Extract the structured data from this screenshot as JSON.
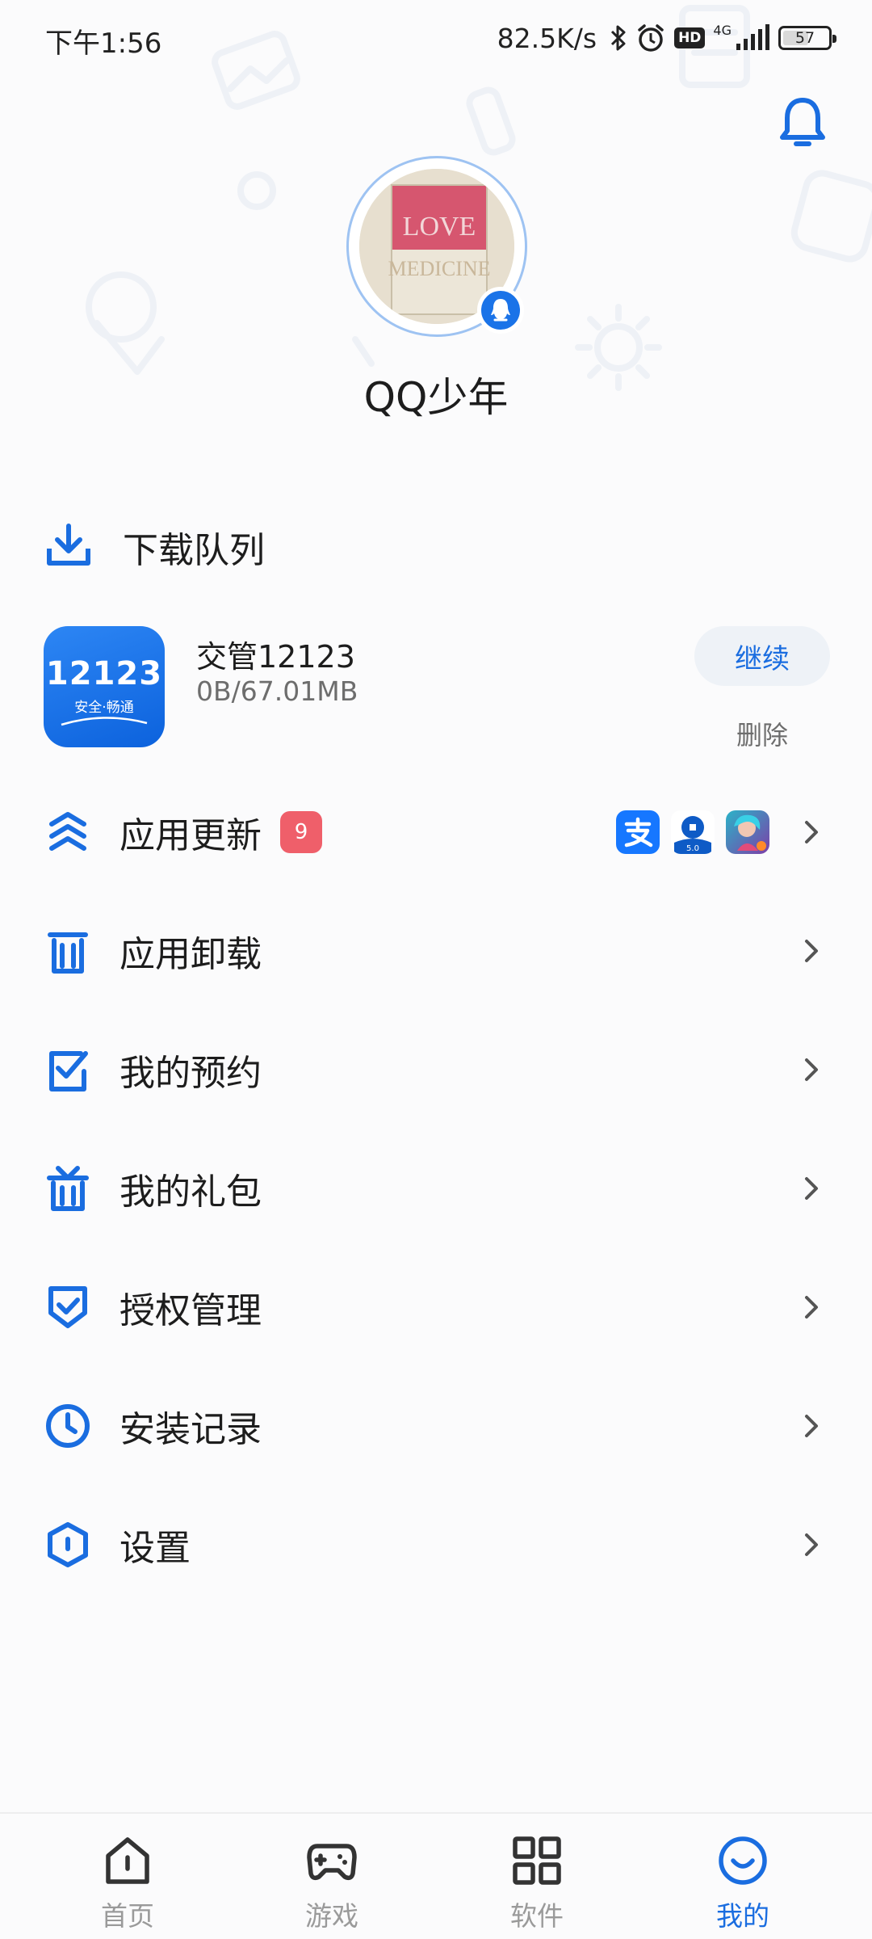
{
  "status_bar": {
    "time": "下午1:56",
    "net_speed": "82.5K/s",
    "hd": "HD",
    "network": "4G",
    "battery": "57",
    "battery_level": 0.57
  },
  "profile": {
    "username": "QQ少年",
    "avatar_text_1": "LOVE",
    "avatar_text_2": "MEDICINE"
  },
  "download_queue": {
    "title": "下载队列",
    "items": [
      {
        "name": "交管12123",
        "size": "0B/67.01MB",
        "icon_text": "12123",
        "icon_subtext": "安全·畅通",
        "continue_label": "继续",
        "delete_label": "删除"
      }
    ]
  },
  "menu": {
    "app_update": {
      "label": "应用更新",
      "badge": "9",
      "mini_apps": [
        "alipay-icon",
        "ccb-icon",
        "game-icon"
      ],
      "mini_ccb_text": "5.0"
    },
    "app_uninstall": {
      "label": "应用卸载"
    },
    "my_reservations": {
      "label": "我的预约"
    },
    "my_gifts": {
      "label": "我的礼包"
    },
    "authorization": {
      "label": "授权管理"
    },
    "install_history": {
      "label": "安装记录"
    },
    "settings": {
      "label": "设置"
    }
  },
  "bottom_nav": {
    "items": [
      {
        "label": "首页",
        "icon": "home-icon"
      },
      {
        "label": "游戏",
        "icon": "gamepad-icon"
      },
      {
        "label": "软件",
        "icon": "grid-icon"
      },
      {
        "label": "我的",
        "icon": "smile-icon",
        "active": true
      }
    ]
  },
  "colors": {
    "accent": "#1a6de0",
    "badge_red": "#ef5f6a",
    "text_primary": "#1d1d1d",
    "text_secondary": "#6d6d6d"
  }
}
